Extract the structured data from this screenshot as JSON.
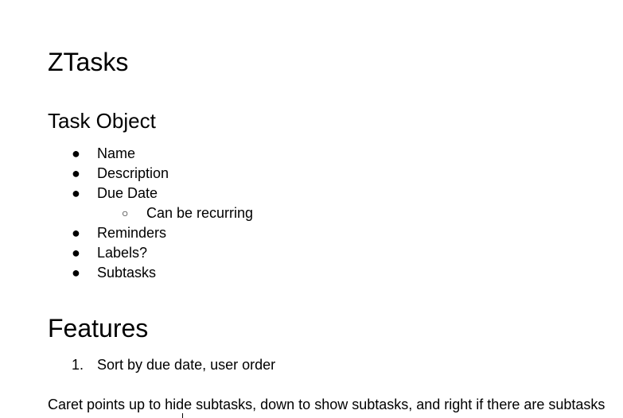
{
  "document": {
    "title": "ZTasks",
    "task_object": {
      "heading": "Task Object",
      "items": [
        {
          "marker": "●",
          "label": "Name"
        },
        {
          "marker": "●",
          "label": "Description"
        },
        {
          "marker": "●",
          "label": "Due Date"
        },
        {
          "marker": "○",
          "label": "Can be recurring",
          "sub": true
        },
        {
          "marker": "●",
          "label": "Reminders"
        },
        {
          "marker": "●",
          "label": "Labels?"
        },
        {
          "marker": "●",
          "label": "Subtasks"
        }
      ]
    },
    "features": {
      "heading": "Features",
      "items": [
        {
          "marker": "1.",
          "label": "Sort by due date, user order"
        }
      ]
    },
    "paragraph": "Caret points up to hide subtasks, down to show subtasks, and right if there are subtasks"
  }
}
